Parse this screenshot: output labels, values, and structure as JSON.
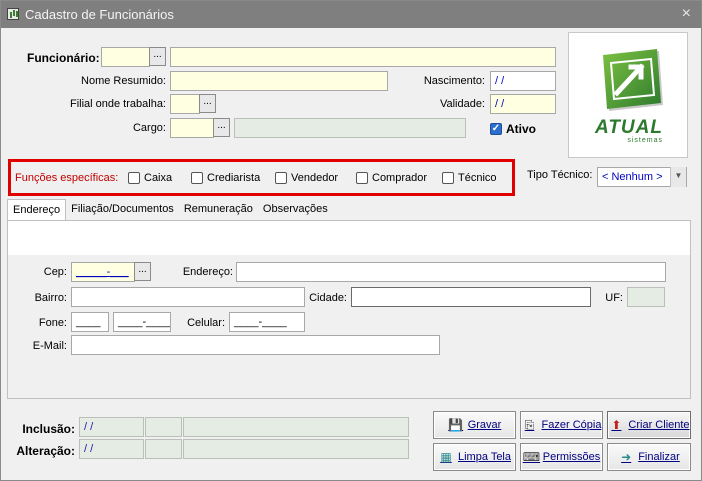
{
  "window": {
    "title": "Cadastro de Funcionários",
    "close": "×"
  },
  "form": {
    "funcionario_label": "Funcionário:",
    "funcionario_code": "",
    "funcionario_name": "",
    "nome_resumido_label": "Nome Resumido:",
    "nome_resumido_value": "",
    "nascimento_label": "Nascimento:",
    "nascimento_value": " /  /",
    "filial_label": "Filial onde trabalha:",
    "filial_value": "",
    "validade_label": "Validade:",
    "validade_value": " /  /",
    "cargo_label": "Cargo:",
    "cargo_value": "",
    "cargo_desc": "",
    "ativo_label": "Ativo",
    "ativo_checked": true,
    "dots": "..."
  },
  "logo": {
    "brand": "ATUAL",
    "sub": "sistemas",
    "color": "#2d7a2e"
  },
  "funcoes": {
    "label": "Funções específicas:",
    "label_color": "#c00000",
    "options": [
      "Caixa",
      "Crediarista",
      "Vendedor",
      "Comprador",
      "Técnico"
    ]
  },
  "tipo_tecnico": {
    "label": "Tipo Técnico:",
    "value": "< Nenhum >"
  },
  "tabs": [
    "Endereço",
    "Filiação/Documentos",
    "Remuneração",
    "Observações"
  ],
  "endereco": {
    "cep_label": "Cep:",
    "cep_value": "_____-___",
    "endereco_label": "Endereço:",
    "bairro_label": "Bairro:",
    "cidade_label": "Cidade:",
    "uf_label": "UF:",
    "fone_label": "Fone:",
    "fone_ddd": "____",
    "fone_num": "____-____",
    "celular_label": "Celular:",
    "celular_value": "____-____",
    "email_label": "E-Mail:"
  },
  "audit": {
    "inclusao_label": "Inclusão:",
    "inclusao_date": " /  /",
    "alteracao_label": "Alteração:",
    "alteracao_date": " /  /"
  },
  "actions": {
    "gravar": "Gravar",
    "fazer_copia": "Fazer Cópia",
    "criar_cliente": "Criar Cliente",
    "limpa_tela": "Limpa Tela",
    "permissoes": "Permissões",
    "finalizar": "Finalizar"
  }
}
